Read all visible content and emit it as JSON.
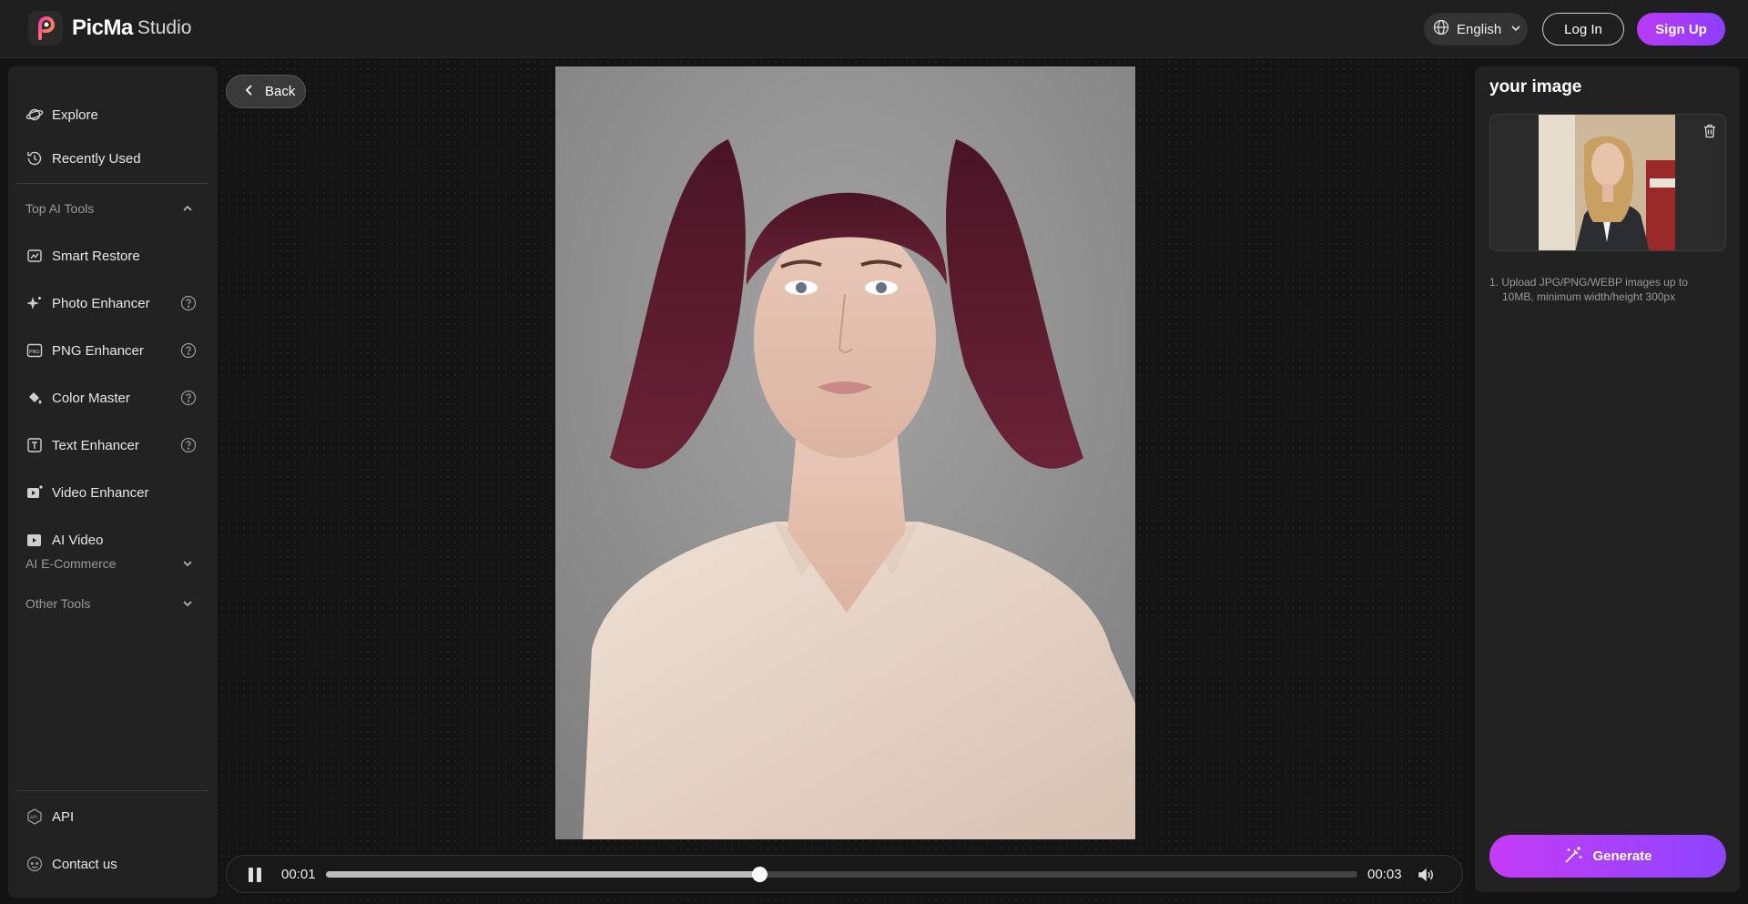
{
  "header": {
    "brand_name": "PicMa",
    "brand_suffix": "Studio",
    "language": "English",
    "login_label": "Log In",
    "signup_label": "Sign Up"
  },
  "sidebar": {
    "top_items": [
      {
        "label": "Explore",
        "icon": "planet-icon"
      },
      {
        "label": "Recently Used",
        "icon": "history-icon"
      }
    ],
    "sections": [
      {
        "title": "Top AI Tools",
        "expanded": true,
        "items": [
          {
            "label": "Smart Restore",
            "icon": "restore-icon",
            "help": false
          },
          {
            "label": "Photo Enhancer",
            "icon": "sparkle-icon",
            "help": true
          },
          {
            "label": "PNG Enhancer",
            "icon": "png-icon",
            "help": true
          },
          {
            "label": "Color Master",
            "icon": "paint-bucket-icon",
            "help": true
          },
          {
            "label": "Text Enhancer",
            "icon": "text-icon",
            "help": true
          },
          {
            "label": "Video Enhancer",
            "icon": "video-sparkle-icon",
            "help": false
          },
          {
            "label": "AI Video",
            "icon": "video-icon",
            "help": false
          }
        ]
      },
      {
        "title": "AI E-Commerce",
        "expanded": false
      },
      {
        "title": "Other Tools",
        "expanded": false
      }
    ],
    "bottom_items": [
      {
        "label": "API",
        "icon": "api-icon"
      },
      {
        "label": "Contact us",
        "icon": "chat-icon"
      }
    ]
  },
  "main": {
    "back_label": "Back",
    "player": {
      "current_time": "00:01",
      "total_time": "00:03",
      "progress": 0.42,
      "state": "playing"
    }
  },
  "panel": {
    "title": "your image",
    "note_line1": "1. Upload JPG/PNG/WEBP images up to",
    "note_line2": "10MB, minimum width/height 300px",
    "generate_label": "Generate"
  },
  "colors": {
    "accent_start": "#b93bf3",
    "accent_end": "#8e3dff",
    "hair": "#5a1a2e",
    "shirt": "#e8d6c9"
  }
}
